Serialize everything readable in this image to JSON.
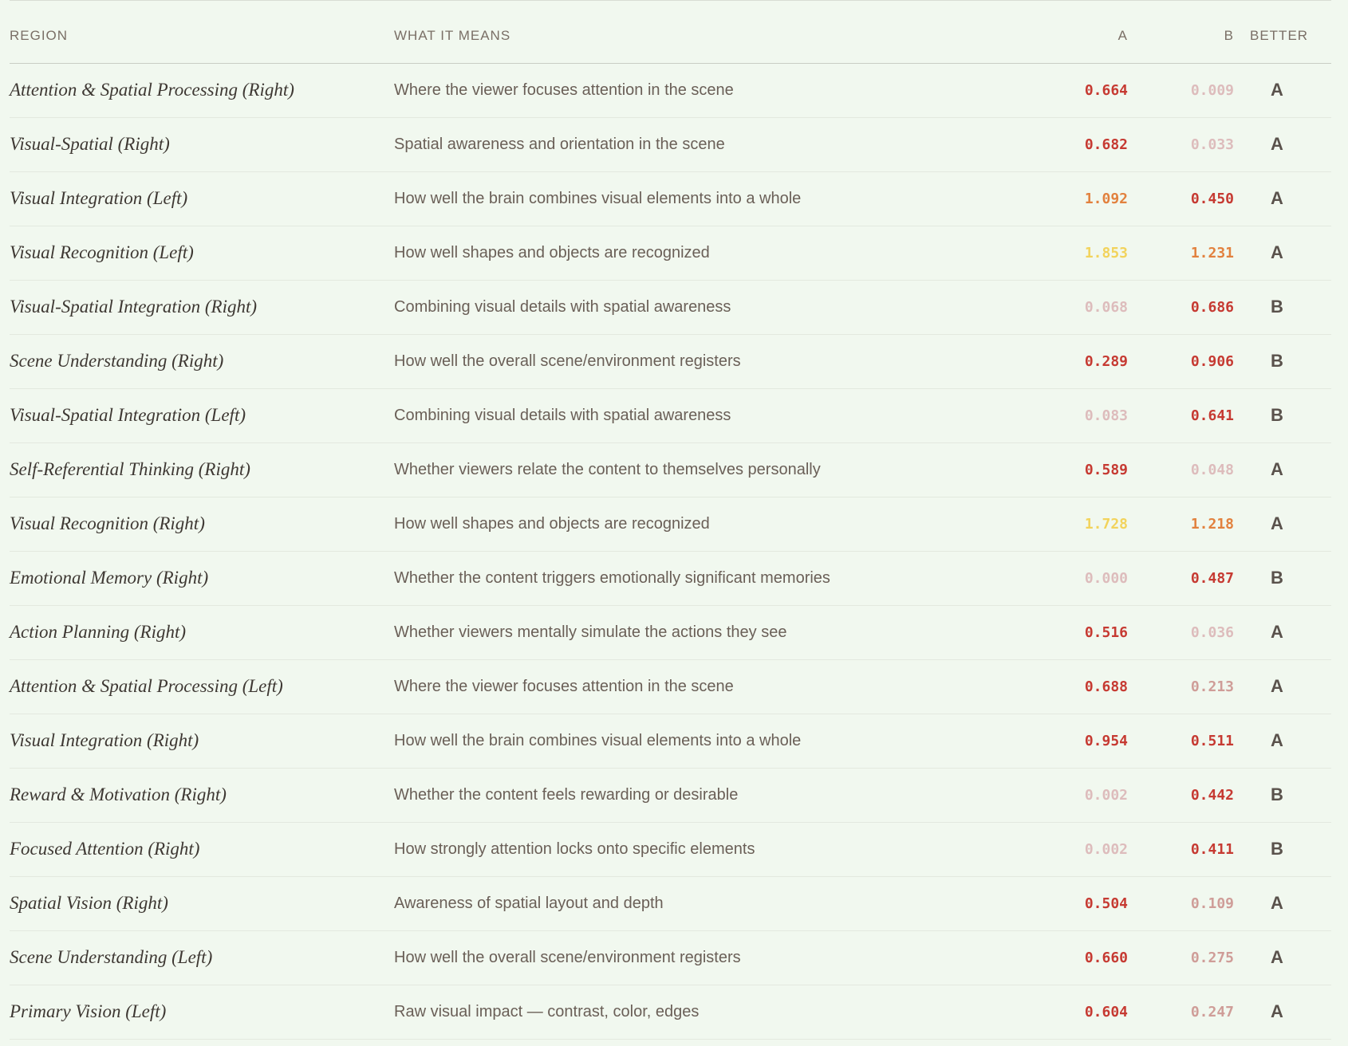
{
  "header": {
    "region": "REGION",
    "means": "WHAT IT MEANS",
    "a": "A",
    "b": "B",
    "better": "BETTER"
  },
  "colors": {
    "faint": "#ddbcbc",
    "light": "#cf9d98",
    "red": "#c63a32",
    "orange": "#e2813e",
    "yellow": "#f2d35c"
  },
  "rows": [
    {
      "region": "Attention & Spatial Processing (Right)",
      "means": "Where the viewer focuses attention in the scene",
      "a": "0.664",
      "b": "0.009",
      "better": "A",
      "a_level": "red",
      "b_level": "faint"
    },
    {
      "region": "Visual-Spatial (Right)",
      "means": "Spatial awareness and orientation in the scene",
      "a": "0.682",
      "b": "0.033",
      "better": "A",
      "a_level": "red",
      "b_level": "faint"
    },
    {
      "region": "Visual Integration (Left)",
      "means": "How well the brain combines visual elements into a whole",
      "a": "1.092",
      "b": "0.450",
      "better": "A",
      "a_level": "orange",
      "b_level": "red"
    },
    {
      "region": "Visual Recognition (Left)",
      "means": "How well shapes and objects are recognized",
      "a": "1.853",
      "b": "1.231",
      "better": "A",
      "a_level": "yellow",
      "b_level": "orange"
    },
    {
      "region": "Visual-Spatial Integration (Right)",
      "means": "Combining visual details with spatial awareness",
      "a": "0.068",
      "b": "0.686",
      "better": "B",
      "a_level": "faint",
      "b_level": "red"
    },
    {
      "region": "Scene Understanding (Right)",
      "means": "How well the overall scene/environment registers",
      "a": "0.289",
      "b": "0.906",
      "better": "B",
      "a_level": "red",
      "b_level": "red"
    },
    {
      "region": "Visual-Spatial Integration (Left)",
      "means": "Combining visual details with spatial awareness",
      "a": "0.083",
      "b": "0.641",
      "better": "B",
      "a_level": "faint",
      "b_level": "red"
    },
    {
      "region": "Self-Referential Thinking (Right)",
      "means": "Whether viewers relate the content to themselves personally",
      "a": "0.589",
      "b": "0.048",
      "better": "A",
      "a_level": "red",
      "b_level": "faint"
    },
    {
      "region": "Visual Recognition (Right)",
      "means": "How well shapes and objects are recognized",
      "a": "1.728",
      "b": "1.218",
      "better": "A",
      "a_level": "yellow",
      "b_level": "orange"
    },
    {
      "region": "Emotional Memory (Right)",
      "means": "Whether the content triggers emotionally significant memories",
      "a": "0.000",
      "b": "0.487",
      "better": "B",
      "a_level": "faint",
      "b_level": "red"
    },
    {
      "region": "Action Planning (Right)",
      "means": "Whether viewers mentally simulate the actions they see",
      "a": "0.516",
      "b": "0.036",
      "better": "A",
      "a_level": "red",
      "b_level": "faint"
    },
    {
      "region": "Attention & Spatial Processing (Left)",
      "means": "Where the viewer focuses attention in the scene",
      "a": "0.688",
      "b": "0.213",
      "better": "A",
      "a_level": "red",
      "b_level": "light"
    },
    {
      "region": "Visual Integration (Right)",
      "means": "How well the brain combines visual elements into a whole",
      "a": "0.954",
      "b": "0.511",
      "better": "A",
      "a_level": "red",
      "b_level": "red"
    },
    {
      "region": "Reward & Motivation (Right)",
      "means": "Whether the content feels rewarding or desirable",
      "a": "0.002",
      "b": "0.442",
      "better": "B",
      "a_level": "faint",
      "b_level": "red"
    },
    {
      "region": "Focused Attention (Right)",
      "means": "How strongly attention locks onto specific elements",
      "a": "0.002",
      "b": "0.411",
      "better": "B",
      "a_level": "faint",
      "b_level": "red"
    },
    {
      "region": "Spatial Vision (Right)",
      "means": "Awareness of spatial layout and depth",
      "a": "0.504",
      "b": "0.109",
      "better": "A",
      "a_level": "red",
      "b_level": "light"
    },
    {
      "region": "Scene Understanding (Left)",
      "means": "How well the overall scene/environment registers",
      "a": "0.660",
      "b": "0.275",
      "better": "A",
      "a_level": "red",
      "b_level": "light"
    },
    {
      "region": "Primary Vision (Left)",
      "means": "Raw visual impact — contrast, color, edges",
      "a": "0.604",
      "b": "0.247",
      "better": "A",
      "a_level": "red",
      "b_level": "light"
    }
  ]
}
